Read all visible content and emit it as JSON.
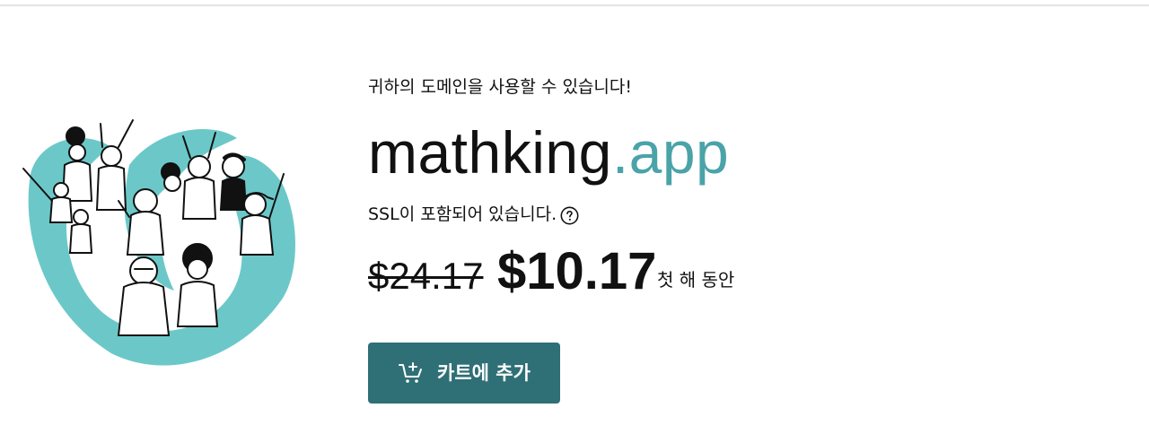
{
  "header": {},
  "illustration": {
    "icon": "crowd-illustration",
    "accent_color": "#6cc8c8"
  },
  "domain_result": {
    "availability_text": "귀하의 도메인을 사용할 수 있습니다!",
    "domain_name": "mathking",
    "domain_tld": ".app",
    "ssl_text": "SSL이 포함되어 있습니다.",
    "help_icon": "question-circle-icon",
    "old_price": "$24.17",
    "new_price": "$10.17",
    "price_period": "첫 해 동안",
    "add_to_cart_label": "카트에 추가",
    "cart_icon": "add-to-cart-icon"
  },
  "colors": {
    "tld": "#4aa3a8",
    "button_bg": "#2f6f76",
    "button_text": "#ffffff",
    "text": "#111111"
  }
}
